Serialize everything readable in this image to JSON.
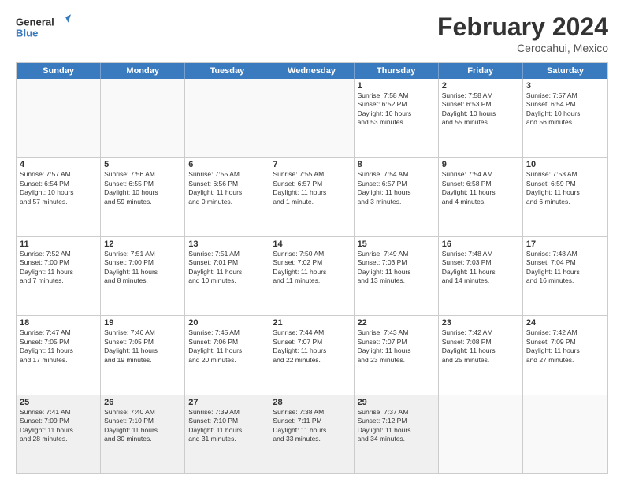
{
  "logo": {
    "line1": "General",
    "line2": "Blue"
  },
  "title": "February 2024",
  "subtitle": "Cerocahui, Mexico",
  "days_of_week": [
    "Sunday",
    "Monday",
    "Tuesday",
    "Wednesday",
    "Thursday",
    "Friday",
    "Saturday"
  ],
  "weeks": [
    [
      {
        "day": "",
        "info": "",
        "empty": true
      },
      {
        "day": "",
        "info": "",
        "empty": true
      },
      {
        "day": "",
        "info": "",
        "empty": true
      },
      {
        "day": "",
        "info": "",
        "empty": true
      },
      {
        "day": "1",
        "info": "Sunrise: 7:58 AM\nSunset: 6:52 PM\nDaylight: 10 hours\nand 53 minutes."
      },
      {
        "day": "2",
        "info": "Sunrise: 7:58 AM\nSunset: 6:53 PM\nDaylight: 10 hours\nand 55 minutes."
      },
      {
        "day": "3",
        "info": "Sunrise: 7:57 AM\nSunset: 6:54 PM\nDaylight: 10 hours\nand 56 minutes."
      }
    ],
    [
      {
        "day": "4",
        "info": "Sunrise: 7:57 AM\nSunset: 6:54 PM\nDaylight: 10 hours\nand 57 minutes."
      },
      {
        "day": "5",
        "info": "Sunrise: 7:56 AM\nSunset: 6:55 PM\nDaylight: 10 hours\nand 59 minutes."
      },
      {
        "day": "6",
        "info": "Sunrise: 7:55 AM\nSunset: 6:56 PM\nDaylight: 11 hours\nand 0 minutes."
      },
      {
        "day": "7",
        "info": "Sunrise: 7:55 AM\nSunset: 6:57 PM\nDaylight: 11 hours\nand 1 minute."
      },
      {
        "day": "8",
        "info": "Sunrise: 7:54 AM\nSunset: 6:57 PM\nDaylight: 11 hours\nand 3 minutes."
      },
      {
        "day": "9",
        "info": "Sunrise: 7:54 AM\nSunset: 6:58 PM\nDaylight: 11 hours\nand 4 minutes."
      },
      {
        "day": "10",
        "info": "Sunrise: 7:53 AM\nSunset: 6:59 PM\nDaylight: 11 hours\nand 6 minutes."
      }
    ],
    [
      {
        "day": "11",
        "info": "Sunrise: 7:52 AM\nSunset: 7:00 PM\nDaylight: 11 hours\nand 7 minutes."
      },
      {
        "day": "12",
        "info": "Sunrise: 7:51 AM\nSunset: 7:00 PM\nDaylight: 11 hours\nand 8 minutes."
      },
      {
        "day": "13",
        "info": "Sunrise: 7:51 AM\nSunset: 7:01 PM\nDaylight: 11 hours\nand 10 minutes."
      },
      {
        "day": "14",
        "info": "Sunrise: 7:50 AM\nSunset: 7:02 PM\nDaylight: 11 hours\nand 11 minutes."
      },
      {
        "day": "15",
        "info": "Sunrise: 7:49 AM\nSunset: 7:03 PM\nDaylight: 11 hours\nand 13 minutes."
      },
      {
        "day": "16",
        "info": "Sunrise: 7:48 AM\nSunset: 7:03 PM\nDaylight: 11 hours\nand 14 minutes."
      },
      {
        "day": "17",
        "info": "Sunrise: 7:48 AM\nSunset: 7:04 PM\nDaylight: 11 hours\nand 16 minutes."
      }
    ],
    [
      {
        "day": "18",
        "info": "Sunrise: 7:47 AM\nSunset: 7:05 PM\nDaylight: 11 hours\nand 17 minutes."
      },
      {
        "day": "19",
        "info": "Sunrise: 7:46 AM\nSunset: 7:05 PM\nDaylight: 11 hours\nand 19 minutes."
      },
      {
        "day": "20",
        "info": "Sunrise: 7:45 AM\nSunset: 7:06 PM\nDaylight: 11 hours\nand 20 minutes."
      },
      {
        "day": "21",
        "info": "Sunrise: 7:44 AM\nSunset: 7:07 PM\nDaylight: 11 hours\nand 22 minutes."
      },
      {
        "day": "22",
        "info": "Sunrise: 7:43 AM\nSunset: 7:07 PM\nDaylight: 11 hours\nand 23 minutes."
      },
      {
        "day": "23",
        "info": "Sunrise: 7:42 AM\nSunset: 7:08 PM\nDaylight: 11 hours\nand 25 minutes."
      },
      {
        "day": "24",
        "info": "Sunrise: 7:42 AM\nSunset: 7:09 PM\nDaylight: 11 hours\nand 27 minutes."
      }
    ],
    [
      {
        "day": "25",
        "info": "Sunrise: 7:41 AM\nSunset: 7:09 PM\nDaylight: 11 hours\nand 28 minutes."
      },
      {
        "day": "26",
        "info": "Sunrise: 7:40 AM\nSunset: 7:10 PM\nDaylight: 11 hours\nand 30 minutes."
      },
      {
        "day": "27",
        "info": "Sunrise: 7:39 AM\nSunset: 7:10 PM\nDaylight: 11 hours\nand 31 minutes."
      },
      {
        "day": "28",
        "info": "Sunrise: 7:38 AM\nSunset: 7:11 PM\nDaylight: 11 hours\nand 33 minutes."
      },
      {
        "day": "29",
        "info": "Sunrise: 7:37 AM\nSunset: 7:12 PM\nDaylight: 11 hours\nand 34 minutes."
      },
      {
        "day": "",
        "info": "",
        "empty": true
      },
      {
        "day": "",
        "info": "",
        "empty": true
      }
    ]
  ]
}
